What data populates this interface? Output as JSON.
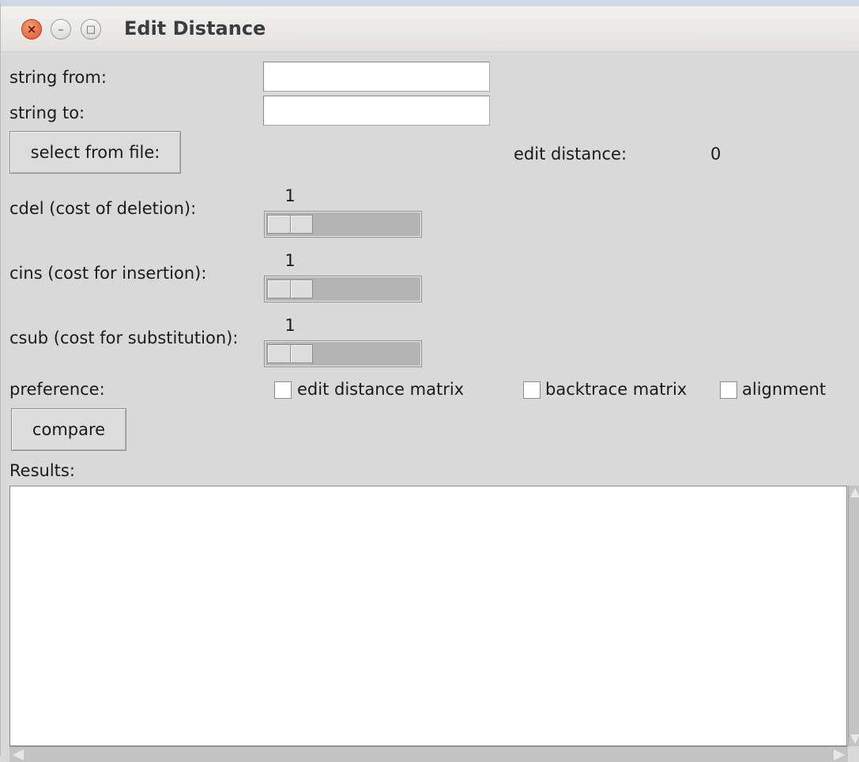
{
  "window": {
    "title": "Edit Distance",
    "close_glyph": "×",
    "minimize_glyph": "–",
    "maximize_glyph": "□"
  },
  "inputs": {
    "string_from_label": "string from:",
    "string_from_value": "",
    "string_to_label": "string to:",
    "string_to_value": ""
  },
  "file": {
    "select_button_label": "select from file:"
  },
  "result_summary": {
    "label": "edit distance:",
    "value": "0"
  },
  "costs": [
    {
      "label": "cdel (cost of deletion):",
      "value": "1",
      "level": 1
    },
    {
      "label": "cins (cost for insertion):",
      "value": "1",
      "level": 1
    },
    {
      "label": "csub (cost for substitution):",
      "value": "1",
      "level": 1
    }
  ],
  "preference": {
    "label": "preference:",
    "options": [
      {
        "label": "edit distance matrix",
        "checked": false
      },
      {
        "label": "backtrace matrix",
        "checked": false
      },
      {
        "label": "alignment",
        "checked": false
      }
    ]
  },
  "actions": {
    "compare_label": "compare"
  },
  "results": {
    "label": "Results:",
    "content": ""
  },
  "colors": {
    "window_bg": "#d9d9d9",
    "close_button": "#e0552a",
    "text_area_bg": "#ffffff"
  }
}
